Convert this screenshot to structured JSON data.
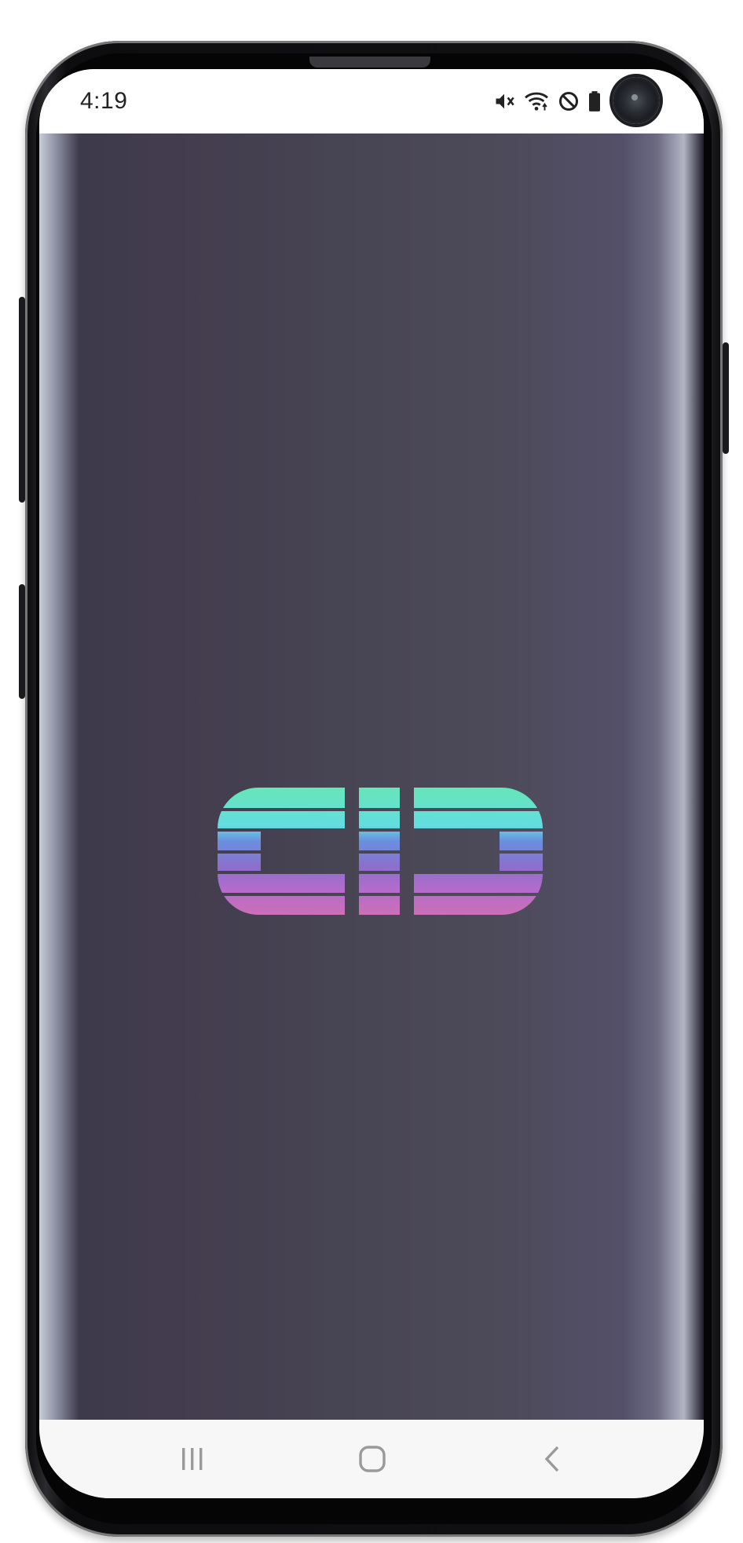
{
  "status_bar": {
    "time": "4:19",
    "icons": [
      "mute-icon",
      "wifi-icon",
      "do-not-disturb-icon",
      "battery-icon"
    ]
  },
  "app": {
    "logo_text": "CID",
    "background_color": "#47445a",
    "logo_gradient": [
      "#66e6b8",
      "#64dde0",
      "#6a8fe0",
      "#8b6fcc",
      "#b36ccb",
      "#cc6fb6"
    ]
  },
  "nav_bar": {
    "buttons": [
      "recent-apps-icon",
      "home-icon",
      "back-icon"
    ]
  }
}
